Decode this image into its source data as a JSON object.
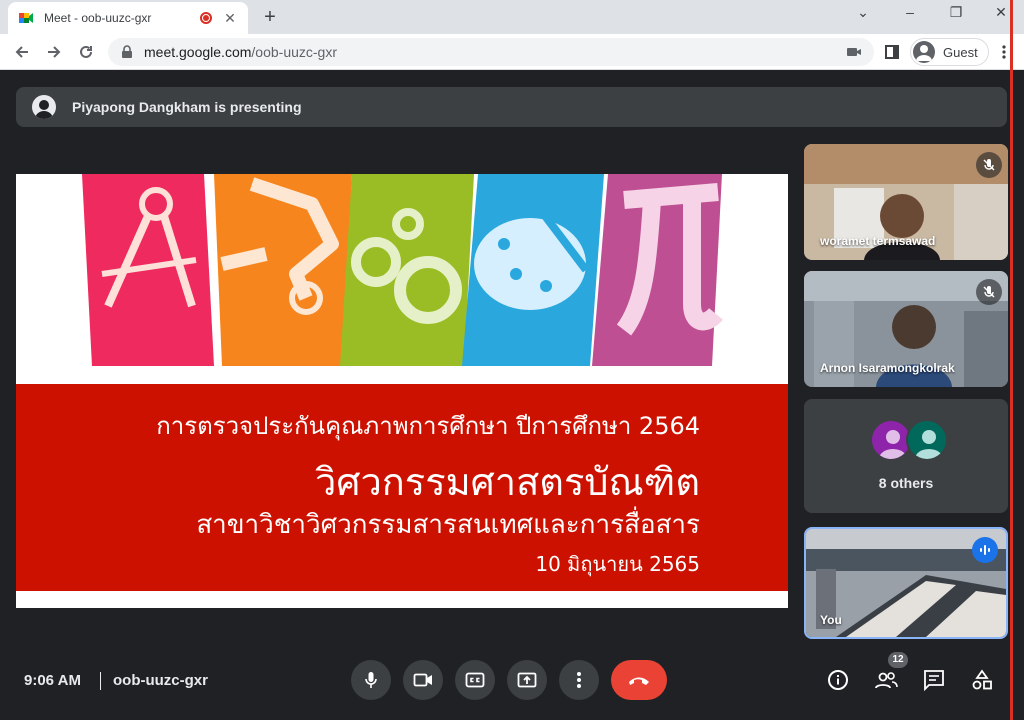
{
  "browser": {
    "tab_title": "Meet - oob-uuzc-gxr",
    "tab_close": "✕",
    "new_tab": "+",
    "url_host": "meet.google.com",
    "url_path": "/oob-uuzc-gxr",
    "profile_label": "Guest",
    "window_minimize": "–",
    "window_restore": "❐",
    "window_close": "✕",
    "tab_search": "⌄"
  },
  "meet": {
    "presenting_banner": "Piyapong Dangkham is presenting",
    "slide": {
      "line1": "การตรวจประกันคุณภาพการศึกษา ปีการศึกษา 2564",
      "line2": "วิศวกรรมศาสตรบัณฑิต",
      "line3": "สาขาวิชาวิศวกรรมสารสนเทศและการสื่อสาร",
      "line4": "10 มิถุนายน 2565"
    },
    "participants": [
      {
        "name": "woramet termsawad",
        "muted": true
      },
      {
        "name": "Arnon Isaramongkolrak",
        "muted": true
      },
      {
        "name": "You",
        "speaking": true
      }
    ],
    "others_label": "8 others",
    "bottom": {
      "time": "9:06 AM",
      "meeting_code": "oob-uuzc-gxr",
      "people_count": "12"
    }
  },
  "colors": {
    "accent": "#1a73e8",
    "end_call": "#ea4335",
    "slide_red": "#cc1100"
  }
}
